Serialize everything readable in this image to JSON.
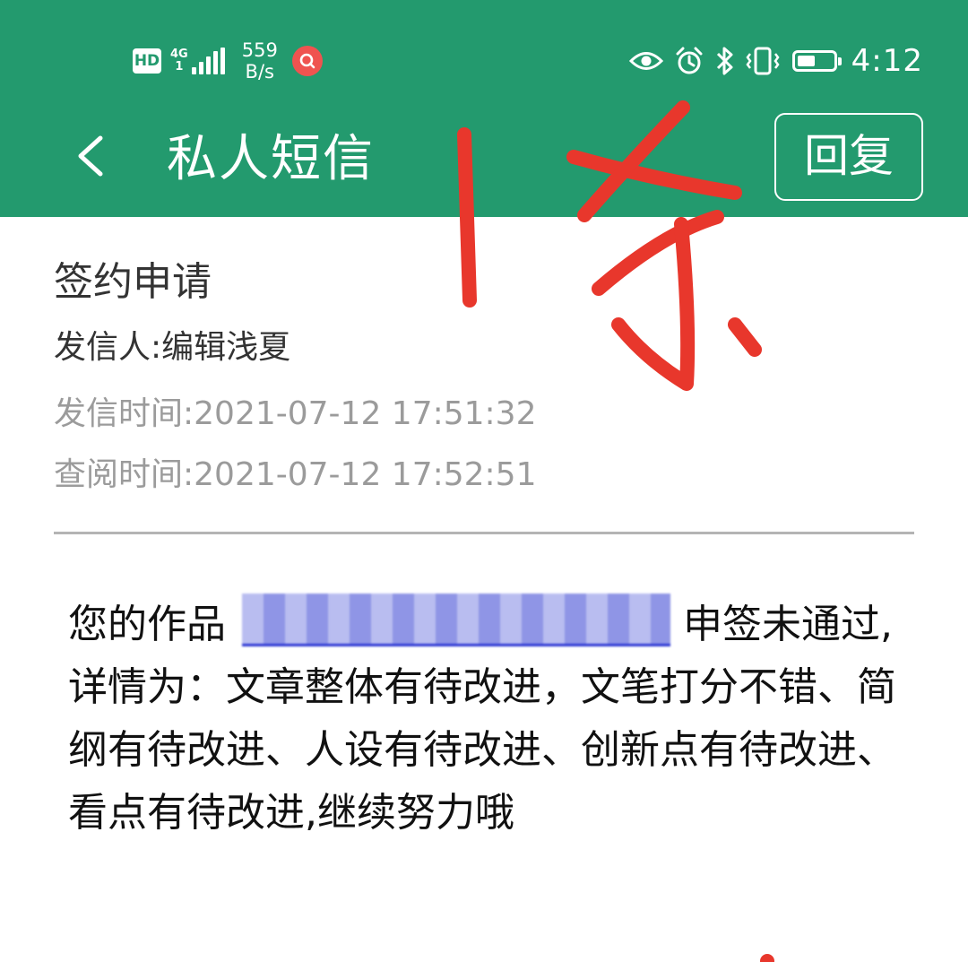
{
  "status_bar": {
    "hd": "HD",
    "network": "4G",
    "network_sub": "1",
    "speed_value": "559",
    "speed_unit": "B/s",
    "time": "4:12",
    "battery_level": 0.45,
    "icons": [
      "eye-icon",
      "alarm-icon",
      "bluetooth-icon",
      "vibrate-icon",
      "battery-icon"
    ]
  },
  "app_bar": {
    "title": "私人短信",
    "reply_label": "回复"
  },
  "message": {
    "subject": "签约申请",
    "sender": "发信人:编辑浅夏",
    "sent_time": "发信时间:2021-07-12 17:51:32",
    "read_time": "查阅时间:2021-07-12 17:52:51",
    "body_prefix": "您的作品",
    "body_suffix": "申签未通过,详情为：文章整体有待改进，文笔打分不错、简纲有待改进、人设有待改进、创新点有待改进、看点有待改进,继续努力哦"
  },
  "colors": {
    "header_green": "#239a6e",
    "annotation_red": "#e8372c",
    "link_blue": "#2f3ad4"
  }
}
